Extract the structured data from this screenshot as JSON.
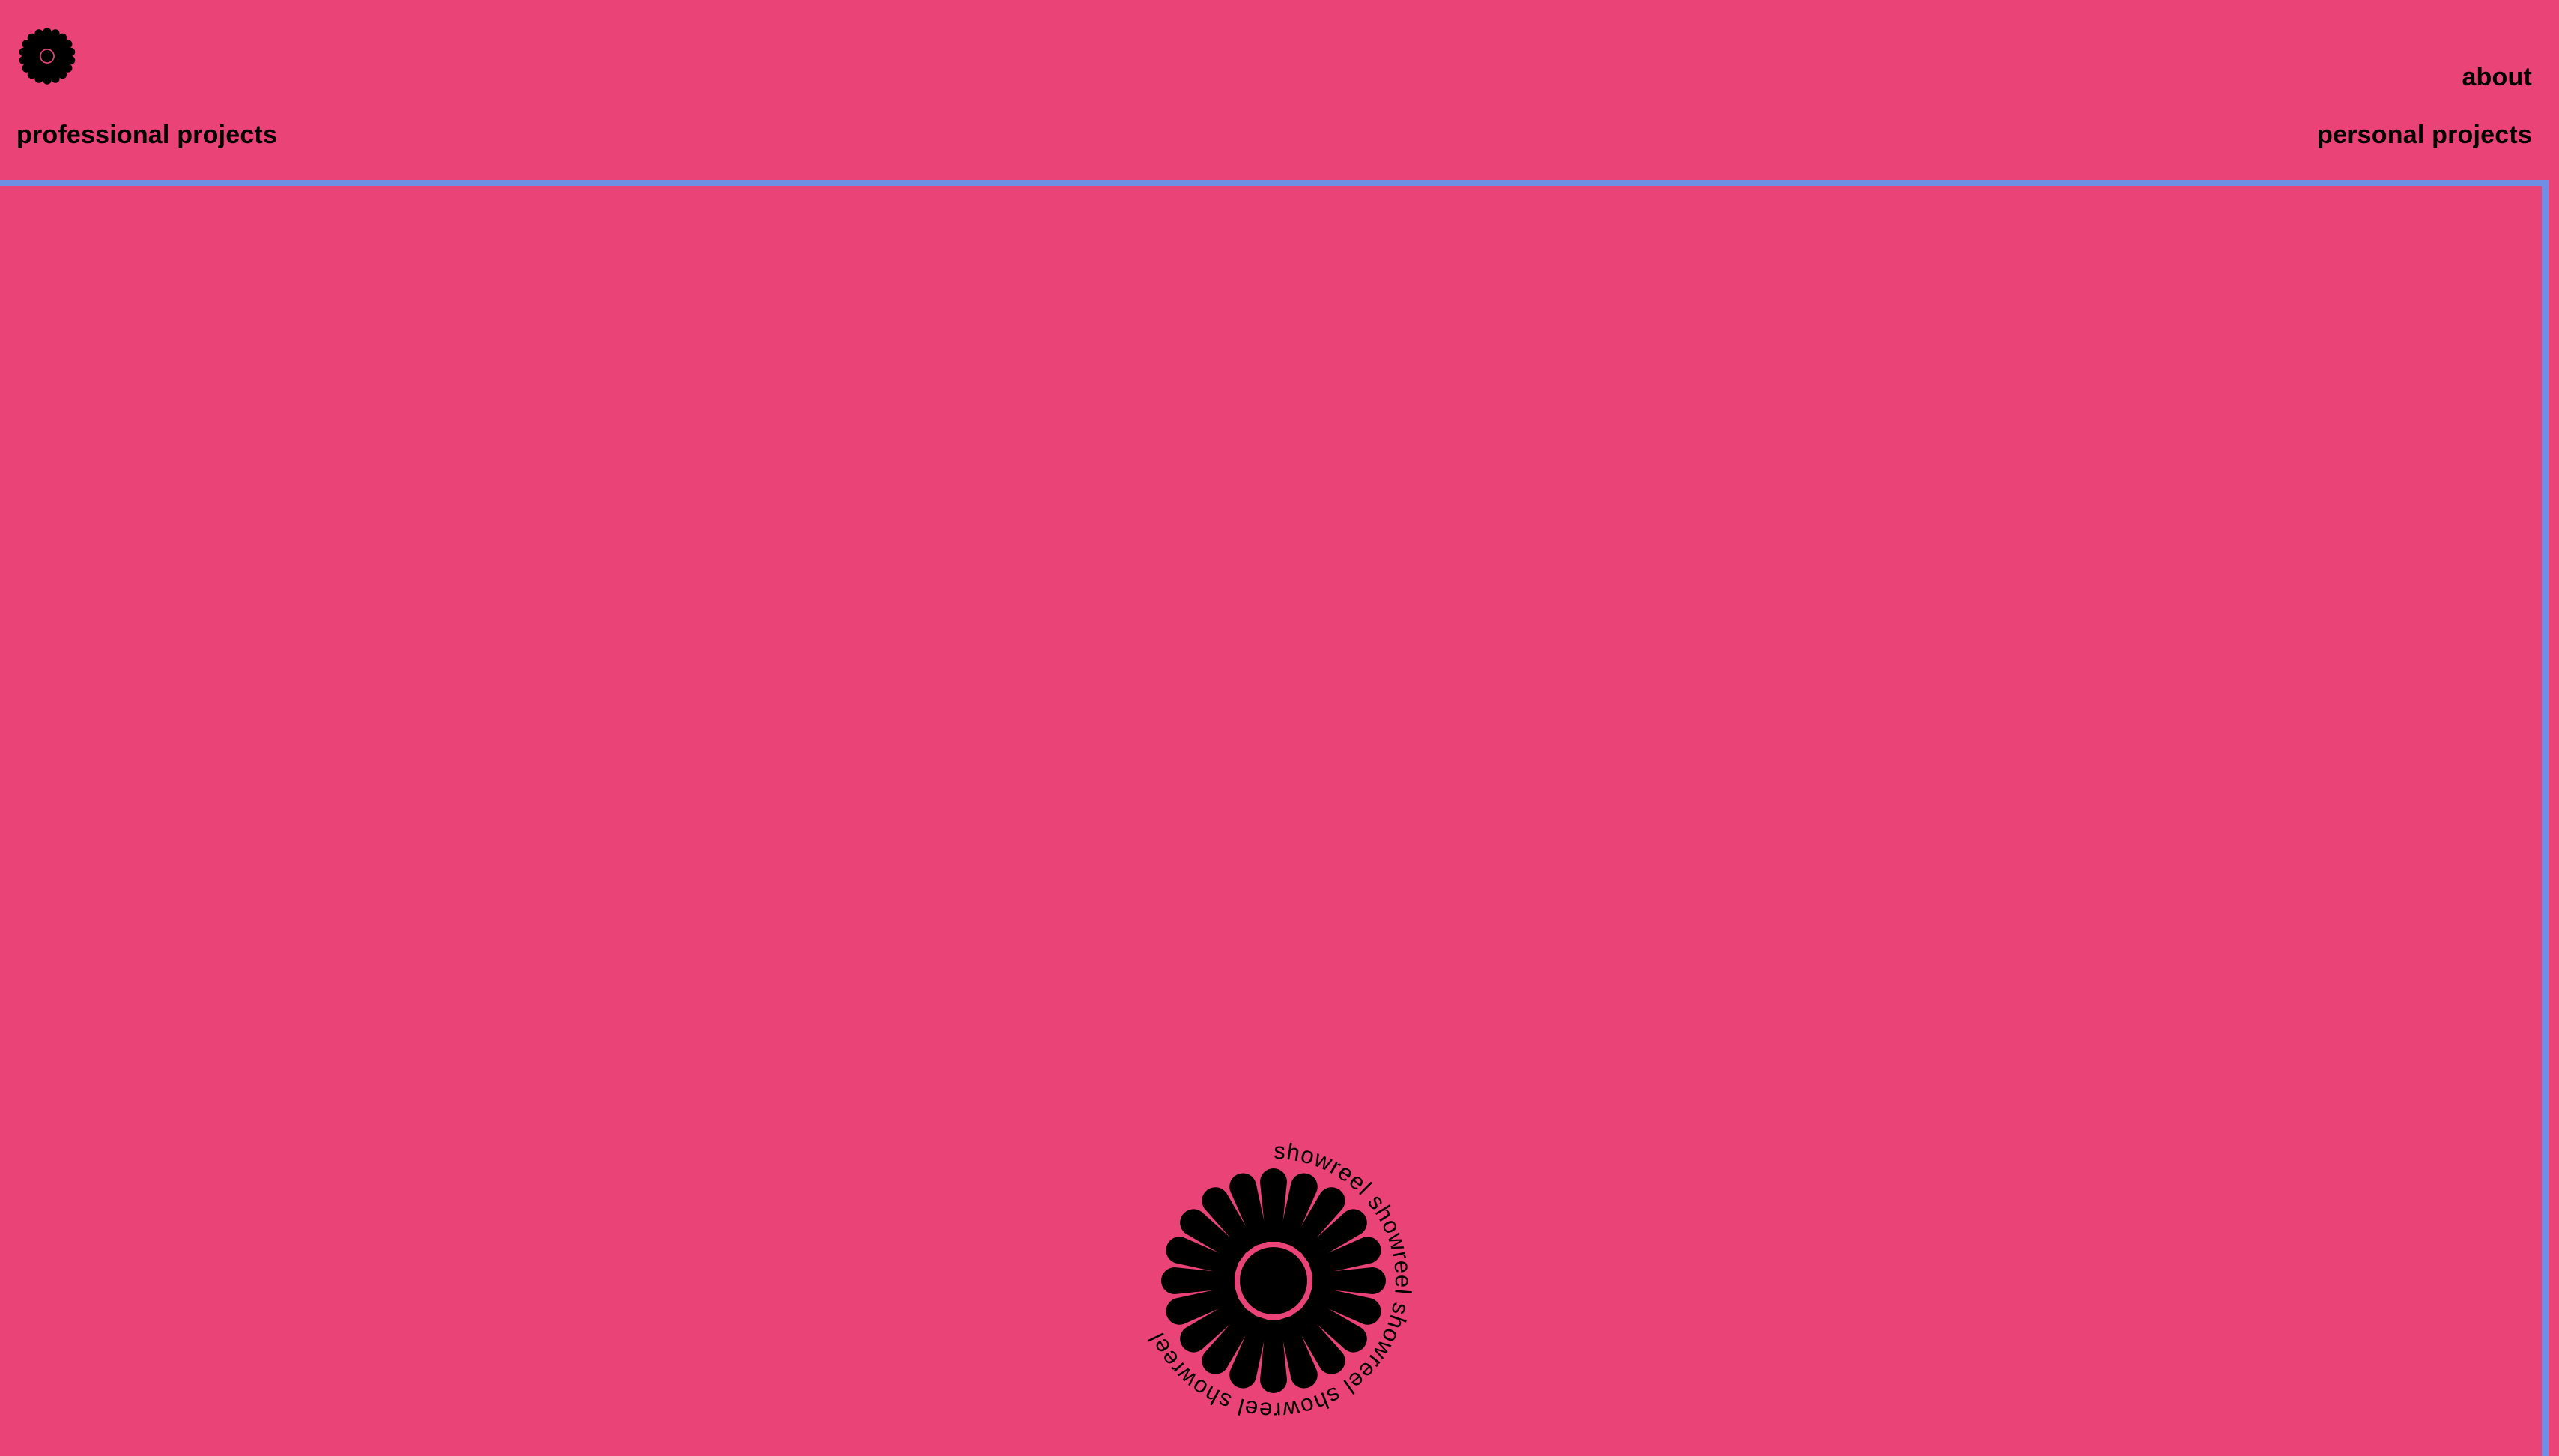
{
  "header": {
    "logo_icon": "flower-icon",
    "nav": {
      "professional": "professional projects",
      "about": "about",
      "personal": "personal projects"
    }
  },
  "main": {
    "frame_border_color": "#6f8fe4",
    "background_color": "#e94377"
  },
  "showreel": {
    "label": "showreel showreel showreel showreel showreel ",
    "icon": "flower-icon"
  }
}
